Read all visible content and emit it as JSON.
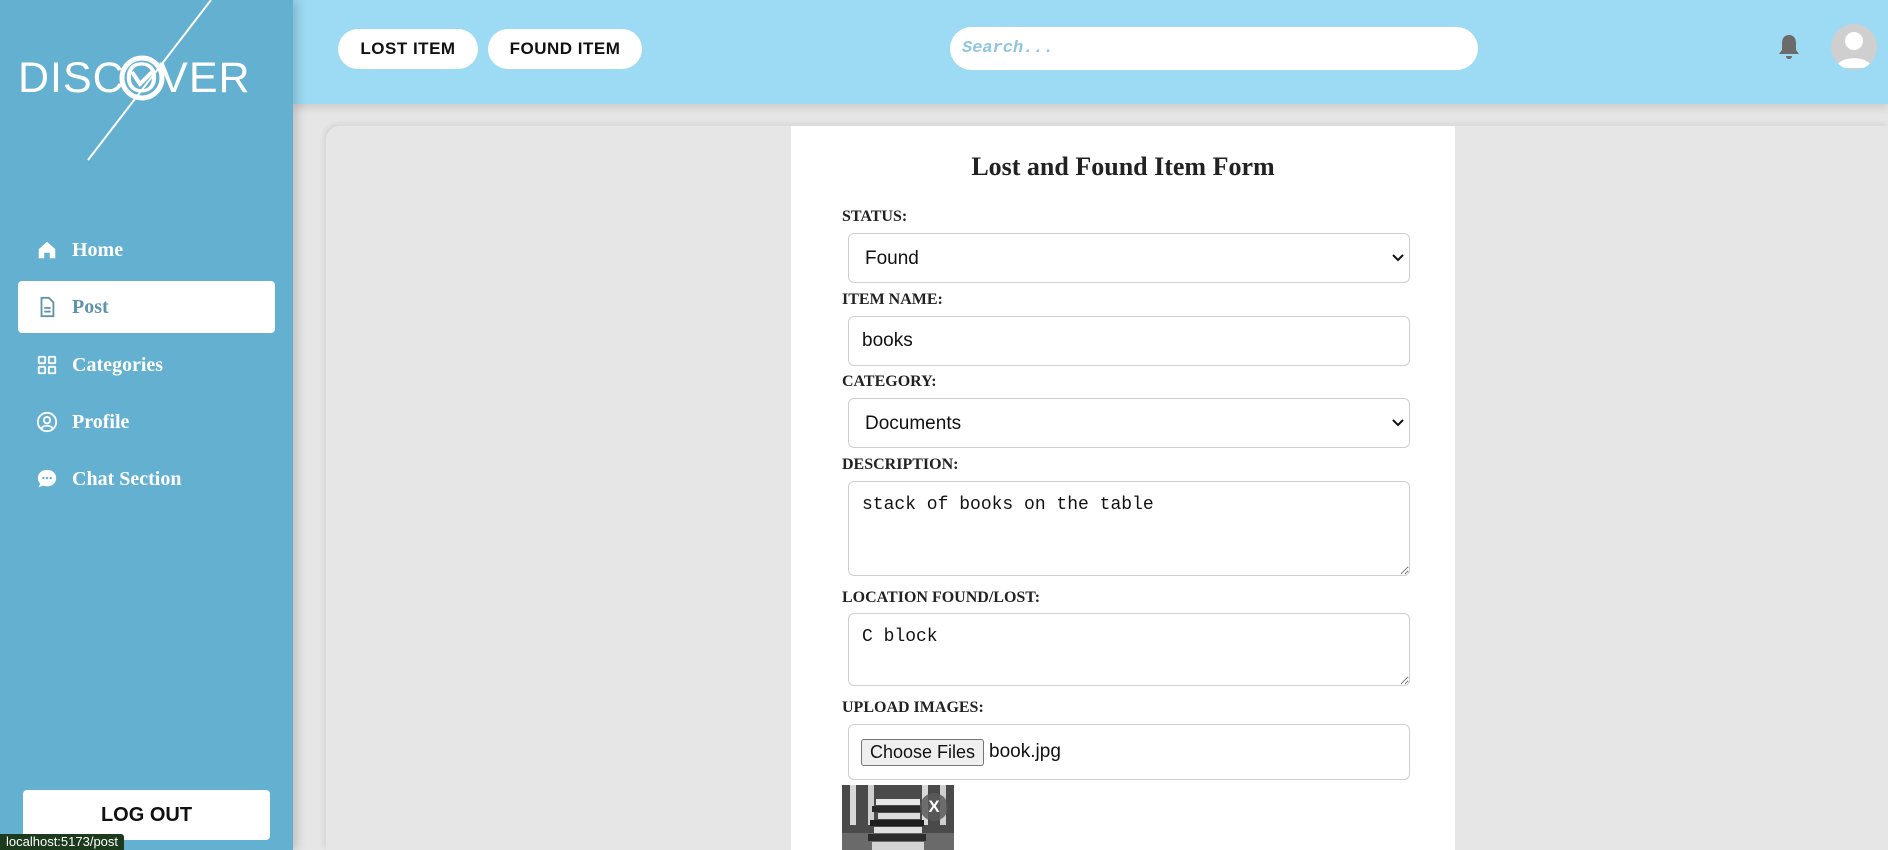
{
  "brand": {
    "logo_text": "DISCOVER"
  },
  "sidebar": {
    "items": [
      {
        "label": "Home",
        "icon": "home-icon"
      },
      {
        "label": "Post",
        "icon": "document-icon",
        "active": true
      },
      {
        "label": "Categories",
        "icon": "grid-icon"
      },
      {
        "label": "Profile",
        "icon": "user-circle-icon"
      },
      {
        "label": "Chat Section",
        "icon": "chat-bubble-icon"
      }
    ],
    "logout_label": "LOG OUT"
  },
  "topbar": {
    "lost_item_label": "LOST ITEM",
    "found_item_label": "FOUND ITEM",
    "search_placeholder": "Search...",
    "notification_icon": "bell-icon",
    "avatar_icon": "user-avatar-icon"
  },
  "form": {
    "title": "Lost and Found Item Form",
    "status": {
      "label": "STATUS:",
      "value": "Found"
    },
    "item_name": {
      "label": "ITEM NAME:",
      "value": "books"
    },
    "category": {
      "label": "CATEGORY:",
      "value": "Documents"
    },
    "description": {
      "label": "DESCRIPTION:",
      "value": "stack of books on the table"
    },
    "location": {
      "label": "LOCATION FOUND/LOST:",
      "value": "C block"
    },
    "upload": {
      "label": "UPLOAD IMAGES:",
      "button_label": "Choose Files",
      "file_name": "book.jpg"
    },
    "preview_remove_label": "X"
  },
  "status_bar": {
    "url": "localhost:5173/post"
  },
  "colors": {
    "sidebar_bg": "#64b0d0",
    "topbar_bg": "#9cdbf3",
    "active_nav_text": "#5f93ad",
    "content_bg": "#e6e6e6"
  }
}
